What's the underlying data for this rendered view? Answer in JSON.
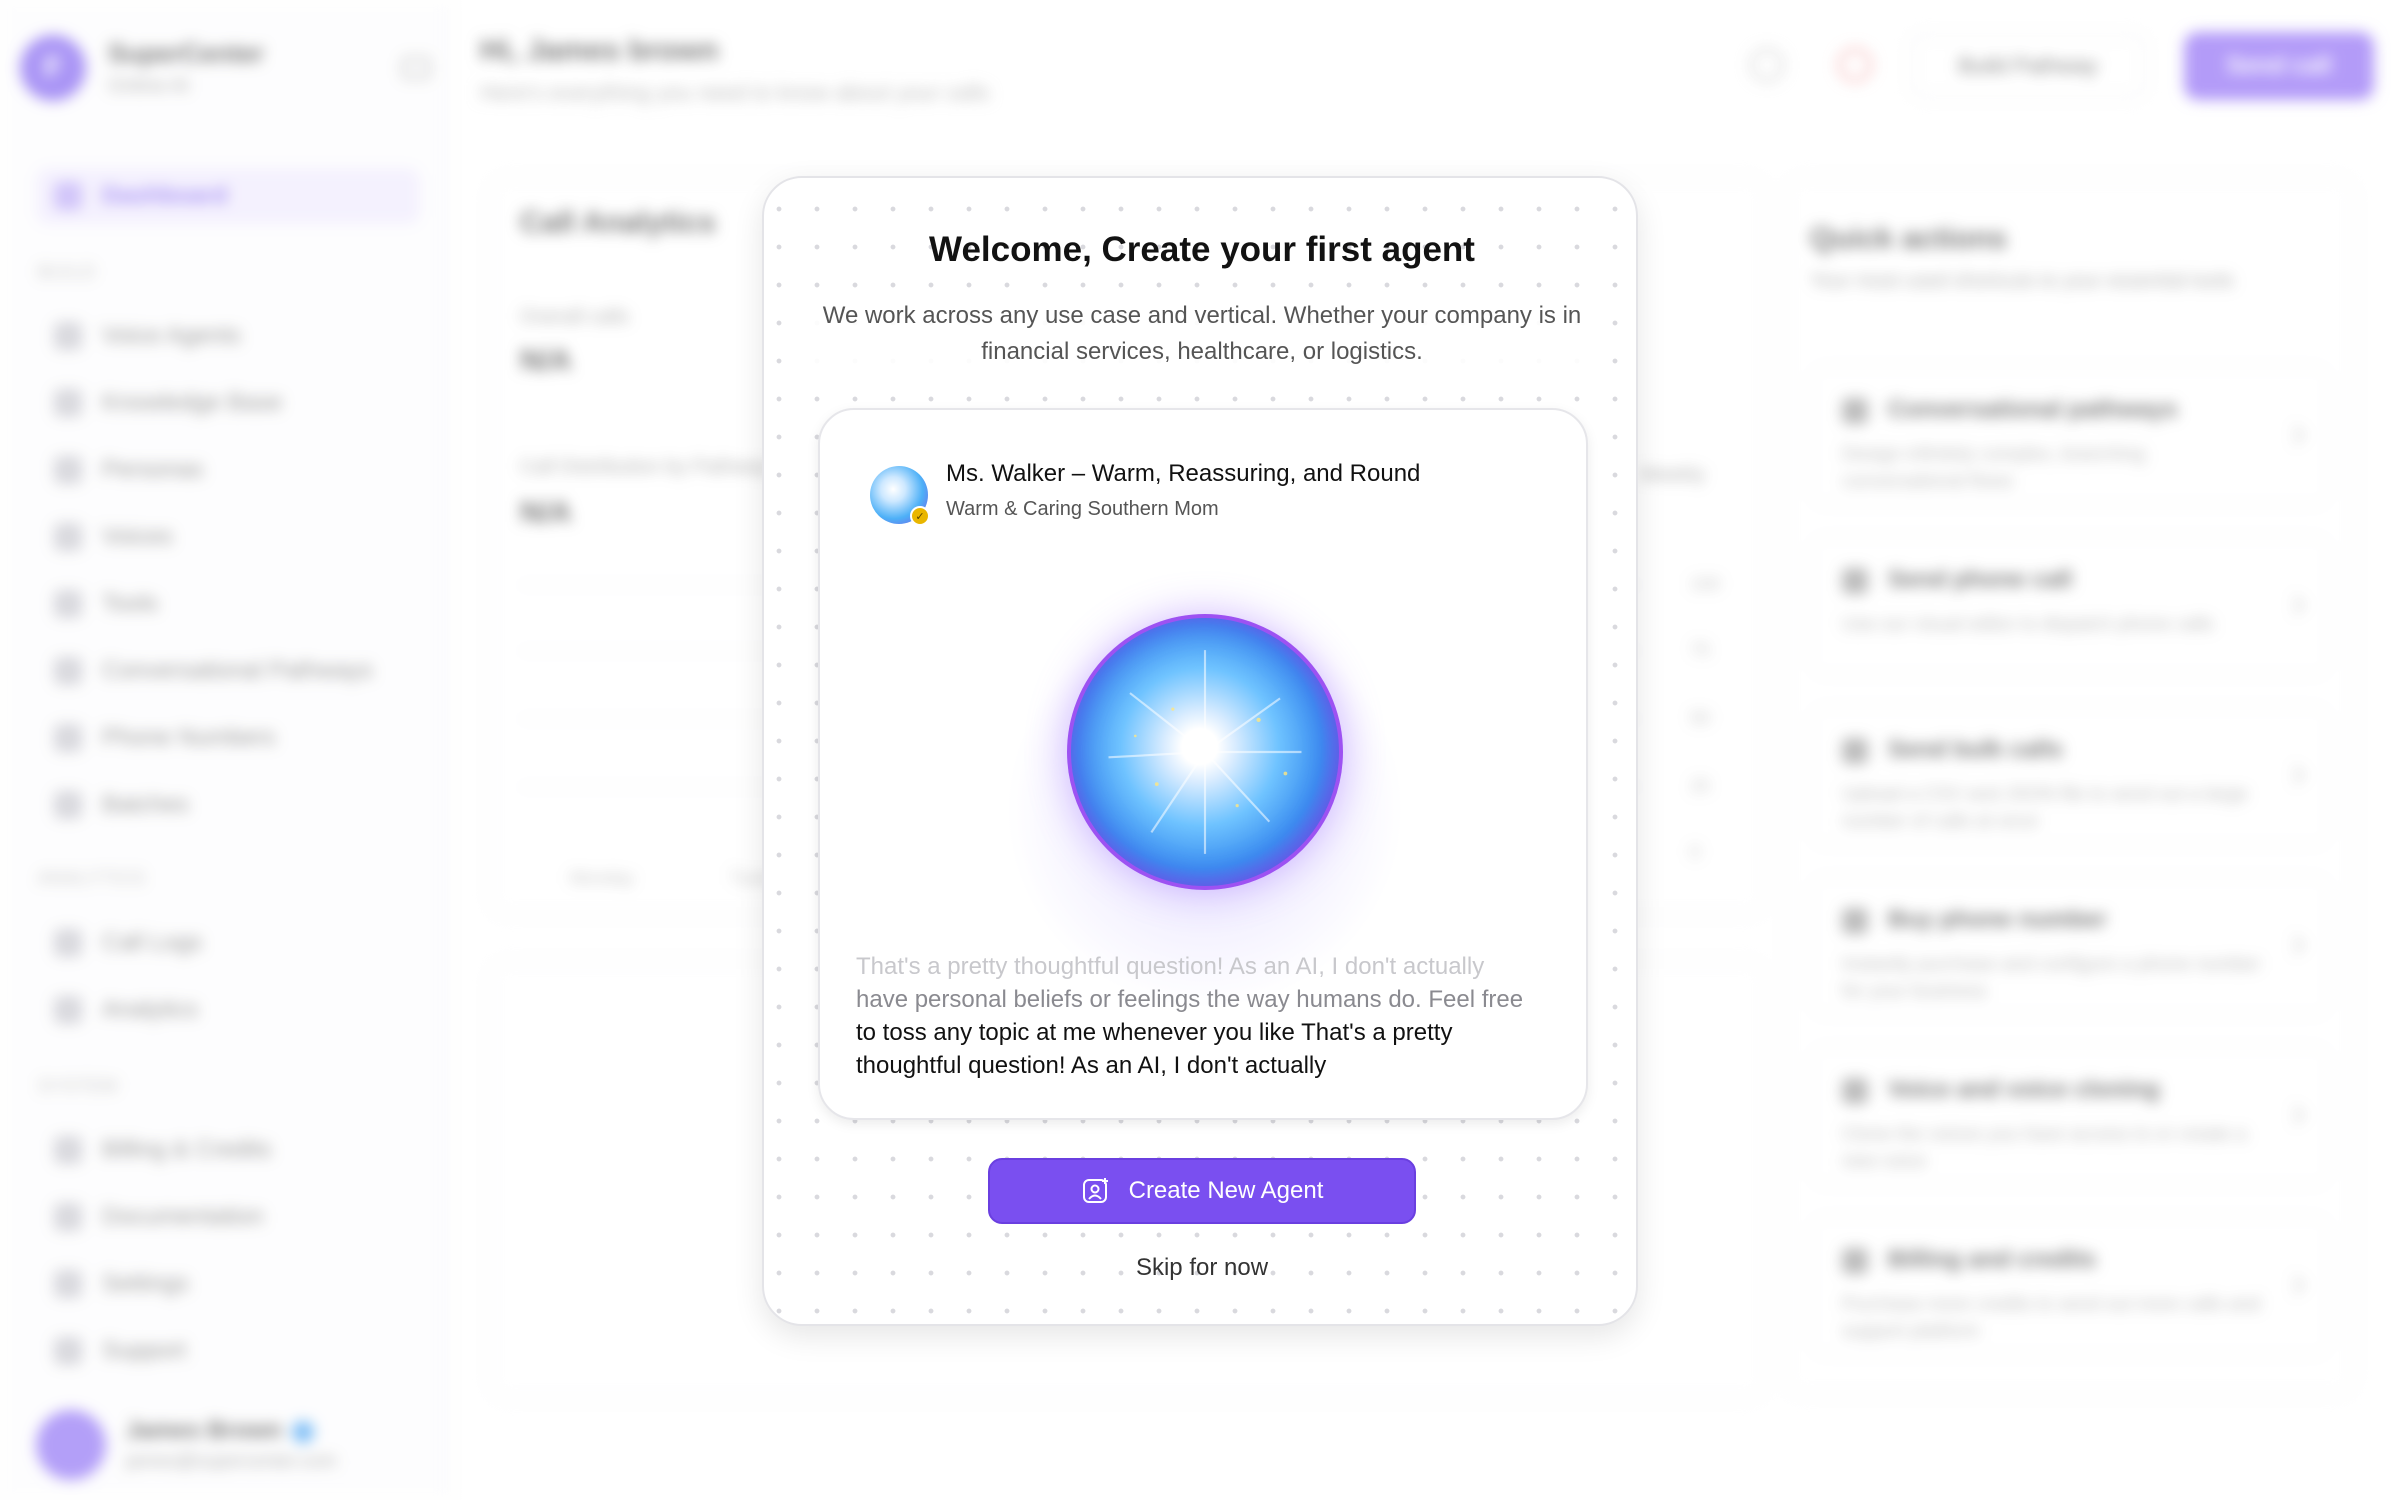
{
  "app": {
    "brand_name": "SuperCenter",
    "brand_sub": "Online AI",
    "brand_initial": "F",
    "greeting": "Hi, James brown",
    "greeting_sub": "Here's everything you need to know about your calls",
    "build_pathway_label": "Build Pathway",
    "send_call_label": "Send call"
  },
  "sidebar": {
    "active": {
      "label": "Dashboard"
    },
    "sections": [
      {
        "title": "BUILD",
        "items": [
          "Voice Agents",
          "Knowledge Base",
          "Personas",
          "Voices",
          "Tools",
          "Conversational Pathways",
          "Phone Numbers",
          "Batches"
        ]
      },
      {
        "title": "ANALYTICS",
        "items": [
          "Call Logs",
          "Analytics"
        ]
      },
      {
        "title": "SYSTEM",
        "items": [
          "Billing & Credits",
          "Documentation",
          "Settings",
          "Support"
        ]
      }
    ],
    "user": {
      "name": "James Brown",
      "email": "james@supercenter.com"
    }
  },
  "analytics": {
    "title": "Call Analytics",
    "metric1_label": "Overall calls",
    "metric1_value": "N/A",
    "metric2_label": "Call Distribution by Pathway",
    "metric2_value": "N/A",
    "filter_label": "Weekly",
    "y_ticks": [
      "100",
      "75",
      "50",
      "25",
      "0"
    ],
    "x_ticks": [
      "Monday",
      "Tuesday"
    ]
  },
  "quick_actions": {
    "title": "Quick actions",
    "subtitle": "Your most used shortcuts to your essential tools",
    "items": [
      {
        "title": "Conversational pathways",
        "desc": "Design infinitely complex, branching conversational flows"
      },
      {
        "title": "Send phone call",
        "desc": "Use our visual editor to dispatch phone calls"
      },
      {
        "title": "Send bulk calls",
        "desc": "Upload a CSV and JSON file to send out a large number of calls at once"
      },
      {
        "title": "Buy phone number",
        "desc": "Instantly purchase and configure a phone number for your business"
      },
      {
        "title": "Voice and voice cloning",
        "desc": "Clone the voices you have access to or create a new voice"
      },
      {
        "title": "Billing and credits",
        "desc": "Purchase more credits to send out more calls and support platform"
      }
    ]
  },
  "modal": {
    "title": "Welcome, Create your first agent",
    "description": "We work across any use case and vertical. Whether your company is in financial services, healthcare, or logistics.",
    "agent": {
      "name": "Ms. Walker – Warm, Reassuring, and Round",
      "subtitle": "Warm & Caring Southern Mom"
    },
    "transcript": {
      "line1": "That's a pretty thoughtful question! As an AI, I don't actually",
      "line2": "have personal beliefs or feelings the way humans do. Feel free",
      "line3": "to toss any topic at me whenever you like That's a pretty",
      "line4": "thoughtful question! As an AI, I don't actually"
    },
    "create_button": "Create New Agent",
    "skip_link": "Skip for now"
  },
  "colors": {
    "accent": "#7a4ff0",
    "orb_ring": "#9d52f2",
    "badge": "#e9b600"
  }
}
